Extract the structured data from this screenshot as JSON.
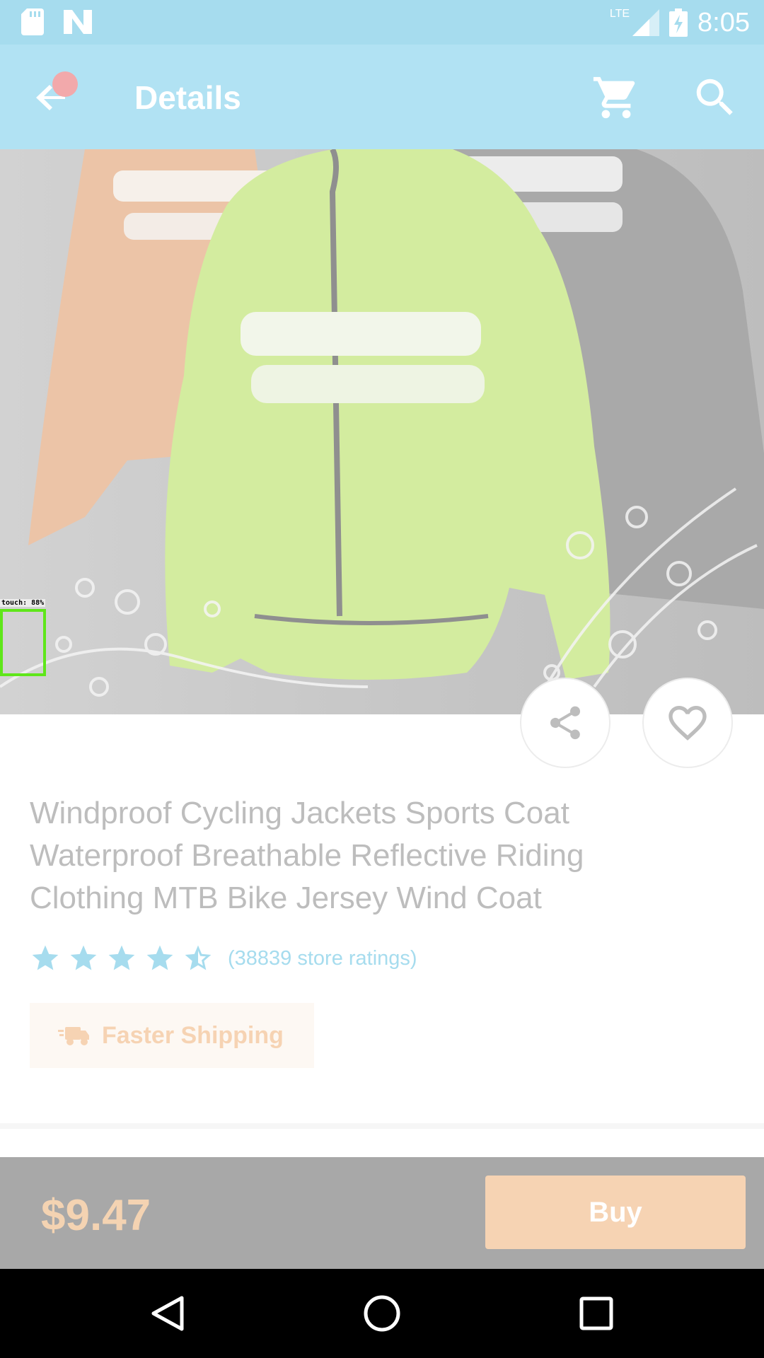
{
  "status_bar": {
    "time": "8:05",
    "network": "LTE",
    "icons": [
      "sd-card-icon",
      "n-notification-icon",
      "signal-icon",
      "battery-charging-icon"
    ]
  },
  "app_bar": {
    "title": "Details",
    "icons": [
      "back-arrow-icon",
      "cart-icon",
      "search-icon"
    ]
  },
  "detection": {
    "label": "touch: 88%"
  },
  "product": {
    "title": "Windproof Cycling Jackets Sports Coat Waterproof Breathable Reflective Riding Clothing MTB Bike Jersey Wind Coat",
    "rating_value": 4.5,
    "rating_max": 5,
    "ratings_text": "(38839 store ratings)",
    "shipping_label": "Faster Shipping"
  },
  "bottom_bar": {
    "price": "$9.47",
    "buy_label": "Buy"
  },
  "colors": {
    "status_bar": "#a6dcee",
    "app_bar": "#b1e2f3",
    "accent_orange": "#f6d3b3",
    "star": "#a6dcee",
    "bottom_bar": "#a8a8a8"
  }
}
